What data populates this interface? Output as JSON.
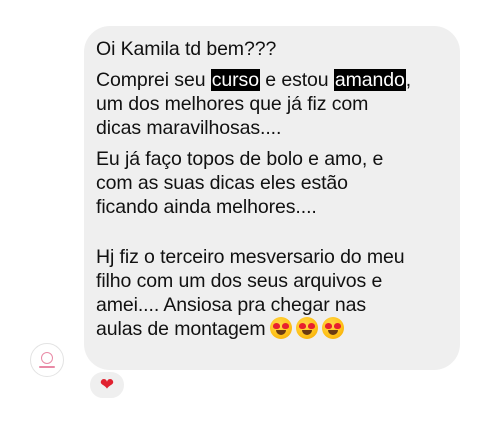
{
  "message": {
    "greeting": "Oi Kamila td bem???",
    "line2_pre": "Comprei seu ",
    "line2_hl1": "curso",
    "line2_mid": " e estou ",
    "line2_hl2": "amando",
    "line2_post": ",",
    "line3": "um dos melhores que já fiz com",
    "line4": "dicas maravilhosas....",
    "line5": "Eu já faço topos de bolo e amo, e",
    "line6": "com as suas dicas eles estão",
    "line7": "ficando ainda melhores....",
    "line8": "Hj fiz o terceiro mesversario do meu",
    "line9": "filho com um dos seus arquivos e",
    "line10": "amei.... Ansiosa pra chegar nas",
    "line11": "aulas de montagem"
  },
  "icons": {
    "emoji": "smiling-face-with-heart-eyes",
    "emoji_count": 3,
    "reaction": "red-heart",
    "avatar": "profile-avatar"
  },
  "colors": {
    "bubble": "#efefef",
    "highlight": "#000000",
    "heart": "#e0212f"
  }
}
